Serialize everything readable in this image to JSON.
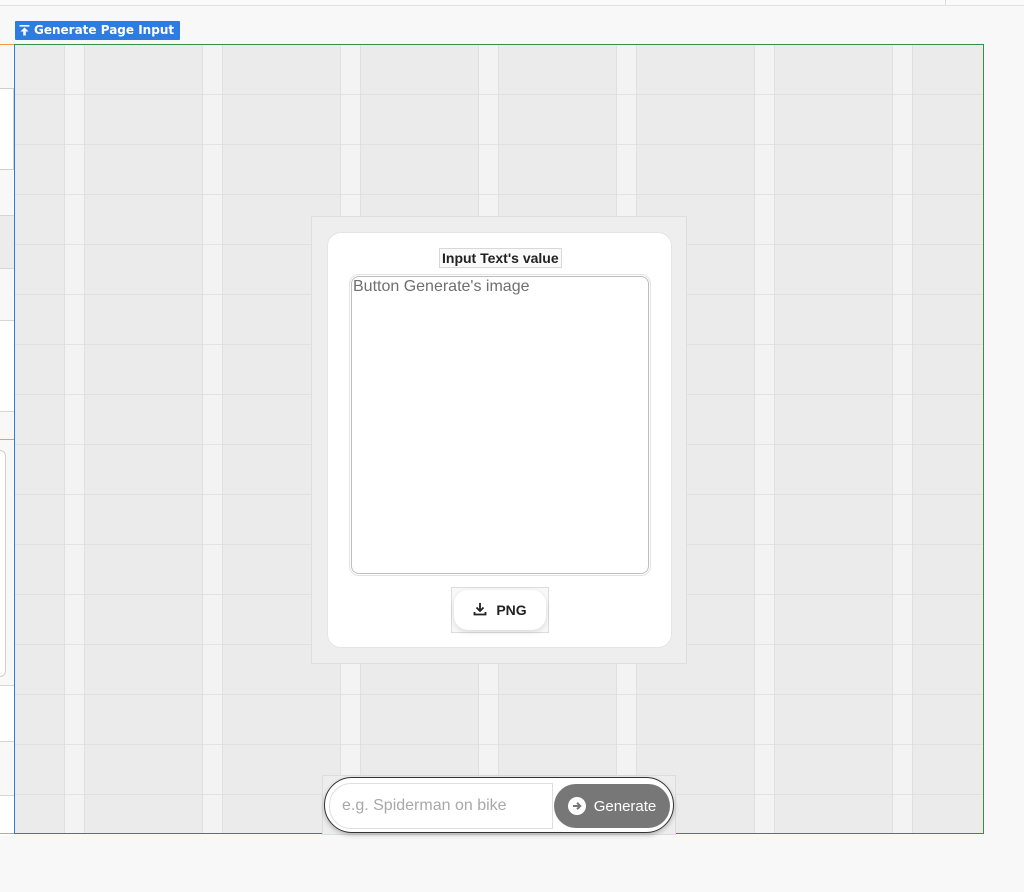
{
  "page_tag": {
    "label": "Generate Page Input",
    "icon": "upload-arrow-icon",
    "color": "#2d7de0"
  },
  "card": {
    "title": "Input Text's value",
    "image_alt": "Button Generate's image",
    "download_button": {
      "label": "PNG",
      "icon": "download-icon"
    }
  },
  "generator": {
    "input_placeholder": "e.g. Spiderman on bike",
    "input_value": "",
    "button_label": "Generate",
    "button_icon": "arrow-right-circle-icon",
    "button_color": "#777777"
  }
}
